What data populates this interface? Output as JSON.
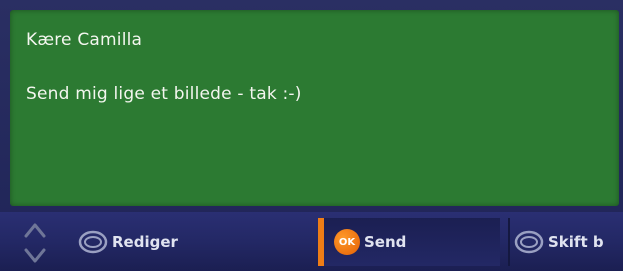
{
  "message": {
    "greeting": "Kære Camilla",
    "body": "Send mig lige et billede - tak :-)"
  },
  "toolbar": {
    "edit_label": "Rediger",
    "send_badge": "OK",
    "send_label": "Send",
    "switch_label": "Skift b"
  },
  "colors": {
    "message_bg": "#2c7a32",
    "bar_bg": "#232865",
    "accent": "#ee7d16",
    "text": "#f3f6ef"
  },
  "icons": {
    "scroll": "up-down-arrows-icon",
    "edit": "ring-button-icon",
    "send": "ok-button-icon",
    "switch": "ring-button-icon"
  }
}
